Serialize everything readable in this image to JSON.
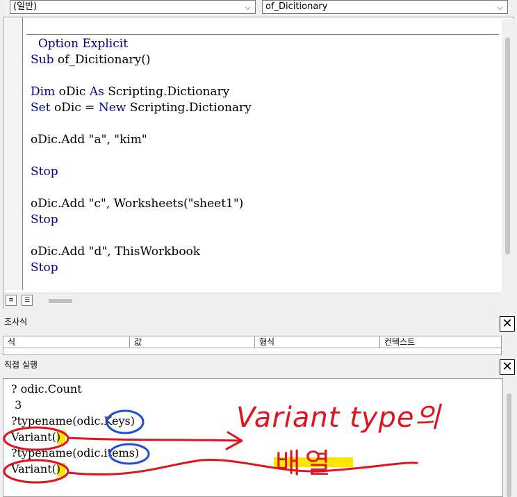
{
  "object_combo": {
    "value": "(일반)"
  },
  "proc_combo": {
    "value": "of_Dicitionary"
  },
  "code_lines": {
    "l1": {
      "kw": "Option Explicit"
    },
    "l2": {
      "kw": "Sub",
      "rest": " of_Dicitionary()"
    },
    "l3": {
      "kw1": "Dim",
      "mid": " oDic ",
      "kw2": "As",
      "rest": " Scripting.Dictionary"
    },
    "l4": {
      "kw1": "Set",
      "mid": " oDic = ",
      "kw2": "New",
      "rest": " Scripting.Dictionary"
    },
    "l5": {
      "text": "oDic.Add \"a\", \"kim\""
    },
    "l6": {
      "kw": "Stop"
    },
    "l7": {
      "text": "oDic.Add \"c\", Worksheets(\"sheet1\")"
    },
    "l8": {
      "kw": "Stop"
    },
    "l9": {
      "text": "oDic.Add \"d\", ThisWorkbook"
    },
    "l10": {
      "kw": "Stop"
    }
  },
  "watch_panel": {
    "title": "조사식",
    "columns": [
      "식",
      "값",
      "형식",
      "컨텍스트"
    ]
  },
  "immediate_panel": {
    "title": "직접 실행",
    "lines": [
      "? odic.Count",
      " 3",
      "?typename(odic.Keys)",
      "Variant()",
      "?typename(odic.items)",
      "Variant()"
    ]
  },
  "annotations": {
    "note_line1": "Variant type의",
    "note_line2": "배열"
  },
  "icons": {
    "close": "close-icon",
    "dropdown": "chevron-down-icon",
    "procedure_view": "procedure-view-icon",
    "full_module_view": "full-module-view-icon"
  },
  "colors": {
    "keyword": "#00008b",
    "annotation_red": "#e0141e",
    "annotation_blue": "#1f4fd8",
    "highlight_yellow": "#ffe600"
  }
}
